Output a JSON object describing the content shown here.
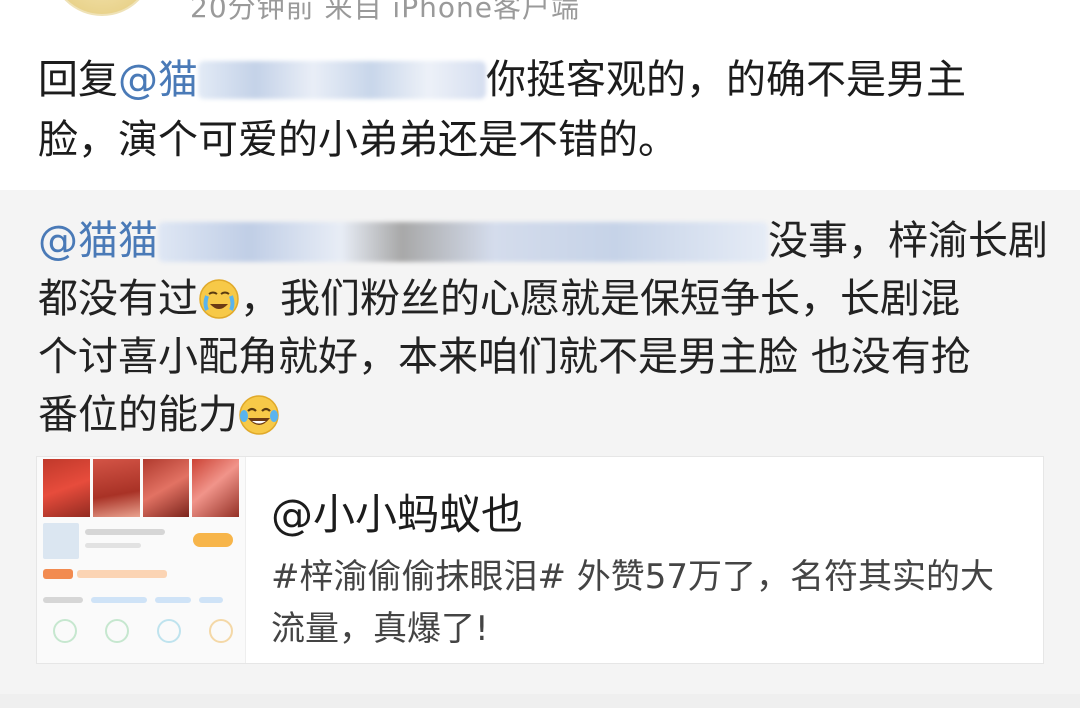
{
  "header": {
    "meta_text": "20分钟前 来自 iPhone客户端"
  },
  "reply": {
    "prefix": "回复",
    "mention_visible": "@猫",
    "line1_after": "你挺客观的，的确不是男主",
    "line2": "脸，演个可爱的小弟弟还是不错的。"
  },
  "quoted": {
    "mention_visible": "@猫猫",
    "line1_after": "没事，梓渝长剧",
    "line2_a": "都没有过",
    "line2_b": "，我们粉丝的心愿就是保短争长，长剧混",
    "line3": "个讨喜小配角就好，本来咱们就不是男主脸 也没有抢",
    "line4": "番位的能力",
    "emoji1": "crying-emoji",
    "emoji2": "laughing-crying-emoji"
  },
  "card": {
    "title": "@小小蚂蚁也",
    "desc_line1": "#梓渝偷偷抹眼泪#  外赞57万了，名符其实的大",
    "desc_line2": "流量，真爆了!"
  }
}
